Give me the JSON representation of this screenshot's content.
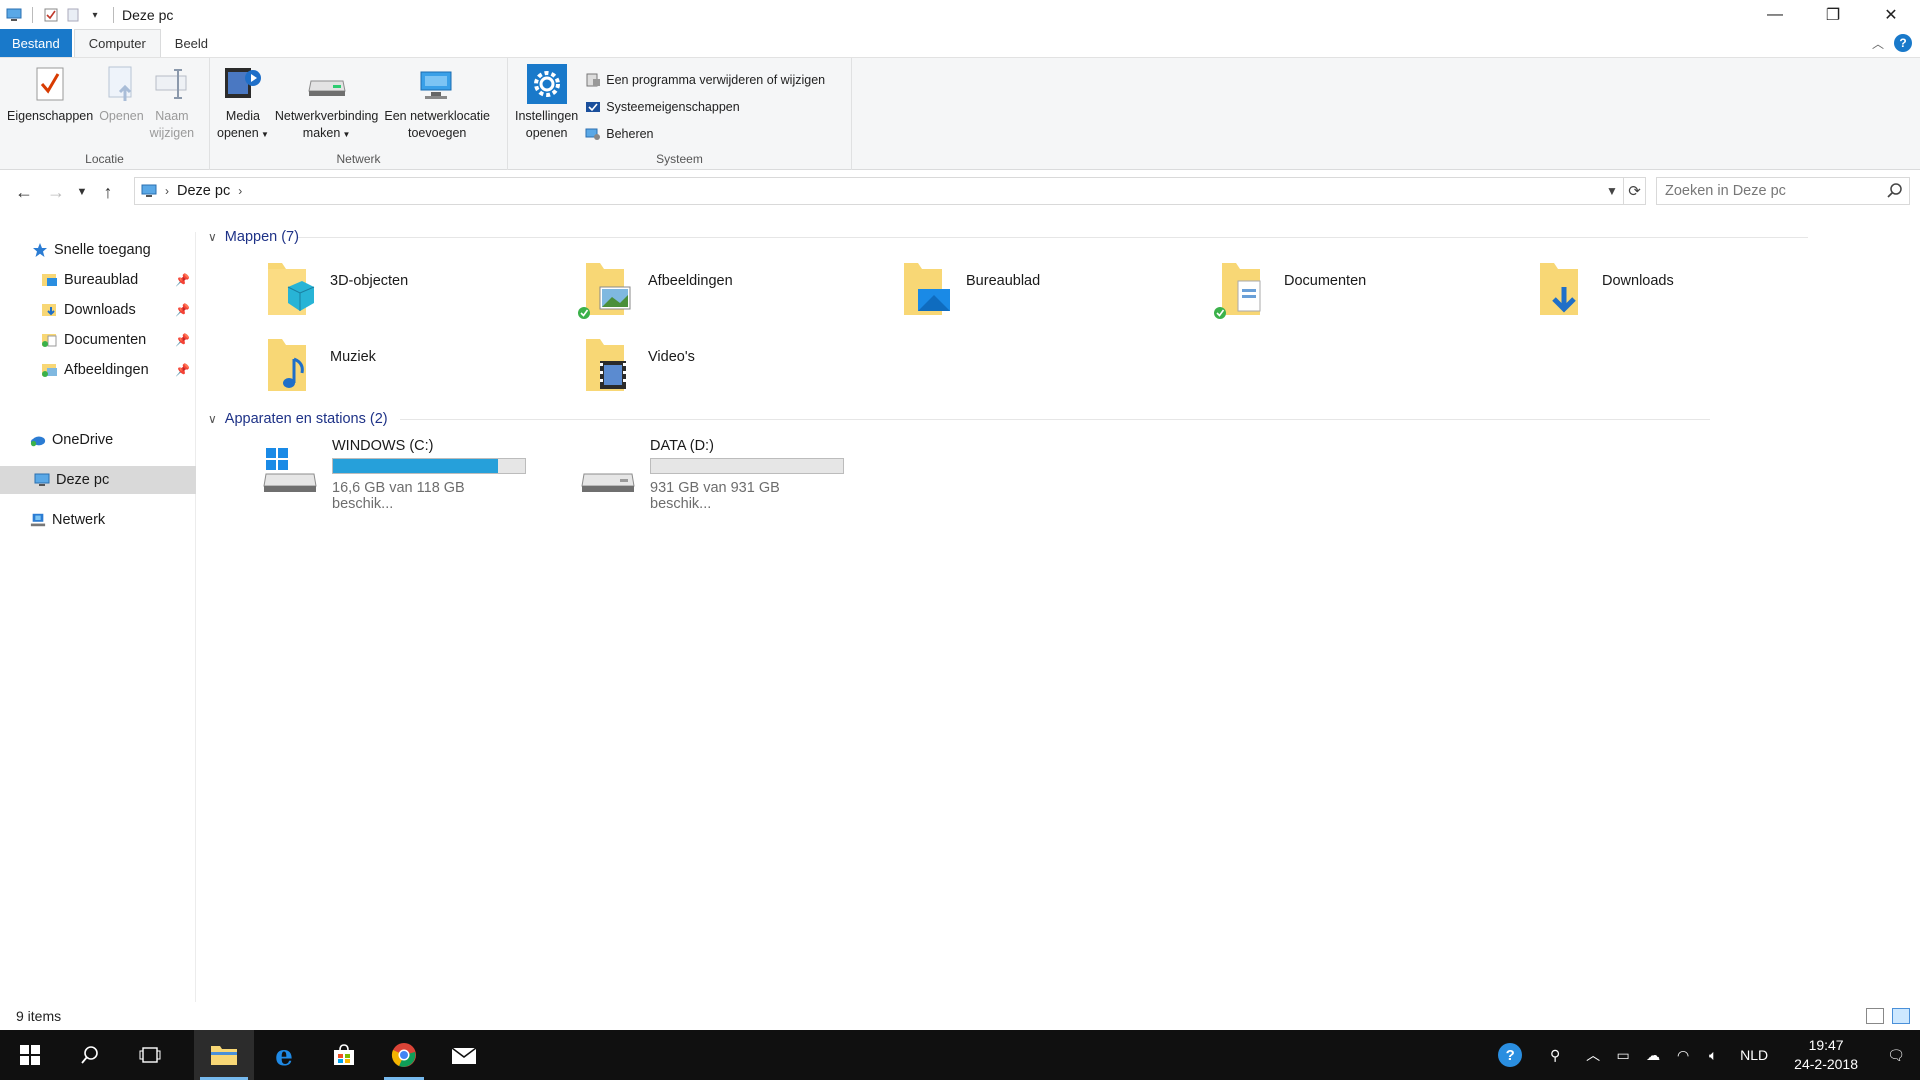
{
  "window": {
    "title": "Deze pc"
  },
  "ribbon_tabs": [
    {
      "label": "Bestand"
    },
    {
      "label": "Computer"
    },
    {
      "label": "Beeld"
    }
  ],
  "ribbon": {
    "locatie": {
      "label": "Locatie",
      "eigenschappen": "Eigenschappen",
      "openen": "Openen",
      "naam_wijzigen_1": "Naam",
      "naam_wijzigen_2": "wijzigen"
    },
    "netwerk": {
      "label": "Netwerk",
      "media_1": "Media",
      "media_2": "openen",
      "netverb_1": "Netwerkverbinding",
      "netverb_2": "maken",
      "netloc_1": "Een netwerklocatie",
      "netloc_2": "toevoegen"
    },
    "systeem": {
      "label": "Systeem",
      "instellingen_1": "Instellingen",
      "instellingen_2": "openen",
      "programma": "Een programma verwijderen of wijzigen",
      "systeemeig": "Systeemeigenschappen",
      "beheren": "Beheren"
    }
  },
  "address": {
    "crumb": "Deze pc",
    "search_placeholder": "Zoeken in Deze pc"
  },
  "navpane": {
    "quick_access": "Snelle toegang",
    "quick_items": [
      {
        "label": "Bureaublad"
      },
      {
        "label": "Downloads"
      },
      {
        "label": "Documenten"
      },
      {
        "label": "Afbeeldingen"
      }
    ],
    "onedrive": "OneDrive",
    "this_pc": "Deze pc",
    "network": "Netwerk"
  },
  "content": {
    "folders_header": "Mappen (7)",
    "folders": [
      {
        "label": "3D-objecten"
      },
      {
        "label": "Afbeeldingen"
      },
      {
        "label": "Bureaublad"
      },
      {
        "label": "Documenten"
      },
      {
        "label": "Downloads"
      },
      {
        "label": "Muziek"
      },
      {
        "label": "Video's"
      }
    ],
    "drives_header": "Apparaten en stations (2)",
    "drives": [
      {
        "name": "WINDOWS (C:)",
        "info": "16,6 GB van 118 GB beschik...",
        "used_fraction": 0.86
      },
      {
        "name": "DATA (D:)",
        "info": "931 GB van 931 GB beschik...",
        "used_fraction": 0.0
      }
    ]
  },
  "statusbar": {
    "items": "9 items"
  },
  "taskbar": {
    "language": "NLD",
    "time": "19:47",
    "date": "24-2-2018"
  },
  "colors": {
    "accent": "#1979ca",
    "drive_fill": "#26a0da",
    "folder": "#f8d775"
  }
}
